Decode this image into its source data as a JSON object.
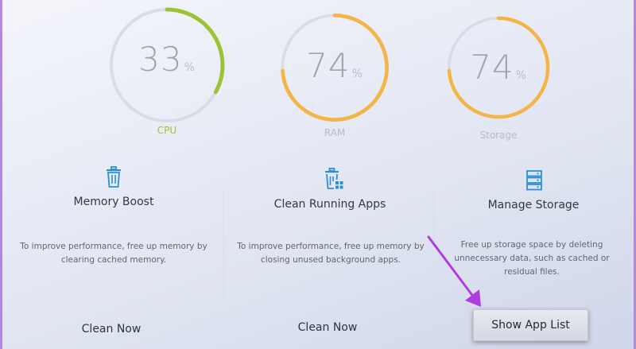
{
  "gauges": [
    {
      "id": "cpu",
      "label": "CPU",
      "value": "33",
      "unit": "%",
      "percent": 33,
      "color": "#9cc236"
    },
    {
      "id": "ram",
      "label": "RAM",
      "value": "74",
      "unit": "%",
      "percent": 74,
      "color": "#f3b548"
    },
    {
      "id": "storage",
      "label": "Storage",
      "value": "74",
      "unit": "%",
      "percent": 74,
      "color": "#f3b548"
    }
  ],
  "panels": [
    {
      "icon": "trash-icon",
      "title": "Memory Boost",
      "description": "To improve performance, free up memory by clearing cached memory.",
      "action": "Clean Now"
    },
    {
      "icon": "trash-cleanup-icon",
      "title": "Clean Running Apps",
      "description": "To improve performance, free up memory by closing unused background apps.",
      "action": "Clean Now"
    },
    {
      "icon": "storage-icon",
      "title": "Manage Storage",
      "description": "Free up storage space by deleting unnecessary data, such as cached or residual files.",
      "action": "Show App List"
    }
  ],
  "colors": {
    "track": "#d8dce5",
    "icon_blue": "#2b8fd6",
    "cpu_label": "#9cc236",
    "ram_label": "#b8bcc4",
    "pointer": "#b03ce0"
  }
}
